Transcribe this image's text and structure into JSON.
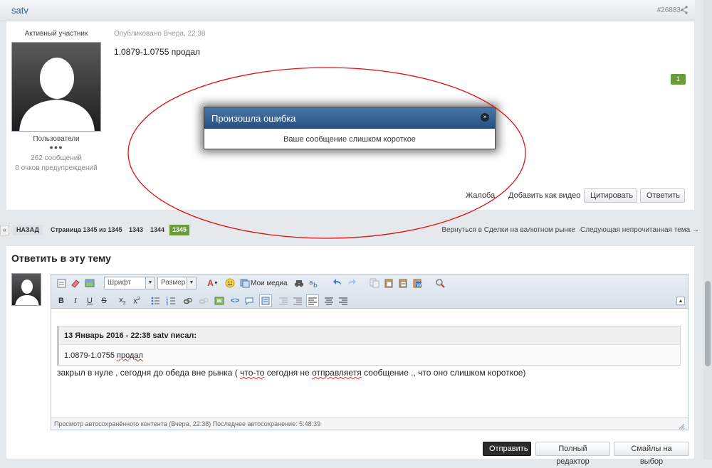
{
  "post": {
    "author": "satv",
    "post_id": "#26883",
    "rank": "Активный участник",
    "group": "Пользователи",
    "rep_dots": "●●●",
    "post_count": "262 сообщений",
    "warning_points": "0 очков предупреждений",
    "published": "Опубликовано Вчера, 22:38",
    "text": "1.0879-1.0755 продал",
    "reputation": "1",
    "actions": {
      "report": "Жалоба",
      "add_video": "Добавить как видео",
      "quote": "Цитировать",
      "reply": "Ответить"
    }
  },
  "pagination": {
    "prev_arrow": "«",
    "back": "НАЗАД",
    "info": "Страница 1345 из 1345",
    "pages": [
      "1343",
      "1344"
    ],
    "current": "1345",
    "back_to": "Вернуться в Сделки на валютном рынке",
    "next_unread": "Следующая непрочитанная тема →"
  },
  "reply": {
    "title": "Ответить в эту тему",
    "toolbar": {
      "font_select": "Шрифт",
      "size_select": "Размер",
      "my_media": "Мои медиа"
    },
    "quote": {
      "header": "13 Январь 2016 - 22:38 satv писал:",
      "text_plain": "1.0879-1.0755",
      "text_word": "продал"
    },
    "body": {
      "part1": "закрыл в нуле , сегодня до обеда вне рынка ( ",
      "misspelled": "что-то",
      "part2": " сегодня не ",
      "misspelled2": "отправляетя",
      "part3": " сообщение ., что оно слишком короткое)"
    },
    "autosave": "Просмотр автосохранённого контента (Вчера, 22:38) Последнее автосохранение: 5:48:39",
    "buttons": {
      "submit": "Отправить",
      "full_editor": "Полный редактор",
      "smileys": "Смайлы на выбор"
    }
  },
  "modal": {
    "title": "Произошла ошибка",
    "message": "Ваше сообщение слишком короткое",
    "close_symbol": "×"
  },
  "colors": {
    "modal_header": "#2f5d8c",
    "annotation": "#e01010",
    "reputation_badge": "#6b9b3a",
    "submit_button": "#2b2b2b"
  }
}
